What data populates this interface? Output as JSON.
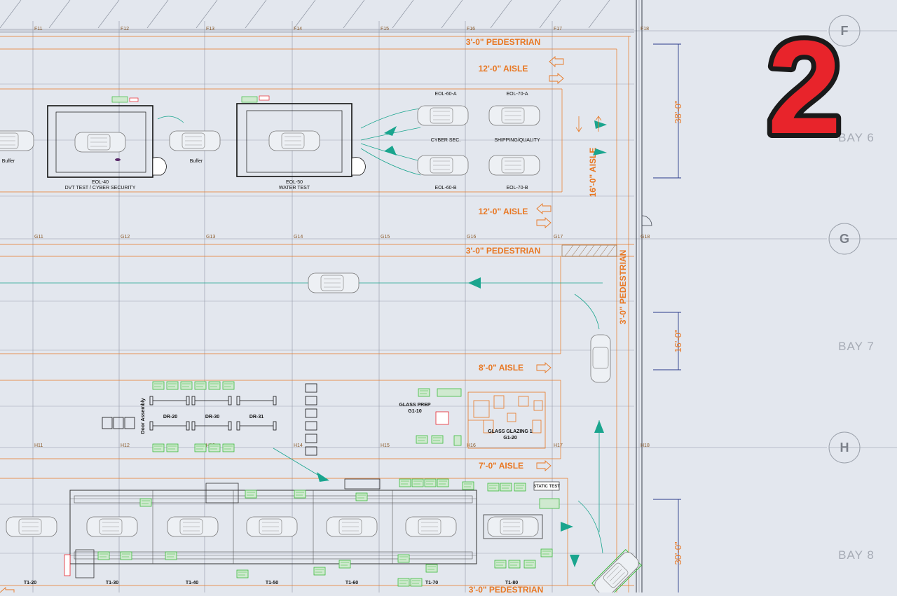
{
  "page_number": "2",
  "grid": {
    "top_labels": [
      "F11",
      "F12",
      "F13",
      "F14",
      "F15",
      "F16",
      "F17",
      "F18"
    ],
    "mid_labels": [
      "G11",
      "G12",
      "G13",
      "G14",
      "G15",
      "G16",
      "G17",
      "G18"
    ],
    "bot_labels": [
      "H11",
      "H12",
      "H13",
      "H14",
      "H15",
      "H16",
      "H17",
      "H18"
    ],
    "bubbles": [
      "F",
      "G",
      "H"
    ]
  },
  "bays": [
    "BAY 6",
    "BAY 7",
    "BAY 8"
  ],
  "dimensions": [
    "38'-0\"",
    "16'-0\"",
    "30'-0\""
  ],
  "aisles": {
    "ped_top": "3'-0\" PEDESTRIAN",
    "aisle_12a": "12'-0\" AISLE",
    "aisle_12b": "12'-0\" AISLE",
    "ped_mid": "3'-0\" PEDESTRIAN",
    "aisle_16": "16'-0\" AISLE",
    "ped_vert": "3'-0\" PEDESTRIAN",
    "aisle_8": "8'-0\" AISLE",
    "aisle_7": "7'-0\" AISLE",
    "ped_bottom": "3'-0\" PEDESTRIAN"
  },
  "stations": {
    "eol40": "EOL-40",
    "eol40_desc": "DVT TEST / CYBER SECURITY",
    "eol50": "EOL-50",
    "eol50_desc": "WATER TEST",
    "buffer1": "Buffer",
    "buffer2": "Buffer",
    "eol60a": "EOL-60-A",
    "eol70a": "EOL-70-A",
    "cyber": "CYBER SEC.",
    "shipping": "SHIPPING/QUALITY",
    "eol60b": "EOL-60-B",
    "eol70b": "EOL-70-B",
    "door_assembly": "Door Assembly",
    "dr20": "DR-20",
    "dr30": "DR-30",
    "dr31": "DR-31",
    "glass_prep": "GLASS PREP",
    "glass_prep_code": "G1-10",
    "glass_glazing": "GLASS GLAZING 1",
    "glass_glazing_code": "G1-20",
    "static_test": "STATIC TEST",
    "t120": "T1-20",
    "t130": "T1-30",
    "t140": "T1-40",
    "t150": "T1-50",
    "t160": "T1-60",
    "t170": "T1-70",
    "t180": "T1-80"
  },
  "colors": {
    "background": "#e3e7ee",
    "grid_line": "#8f96a3",
    "orange": "#e87722",
    "teal": "#1aa58e",
    "green": "#3dbb3d",
    "badge_red": "#e8242b",
    "outline": "#111111"
  }
}
